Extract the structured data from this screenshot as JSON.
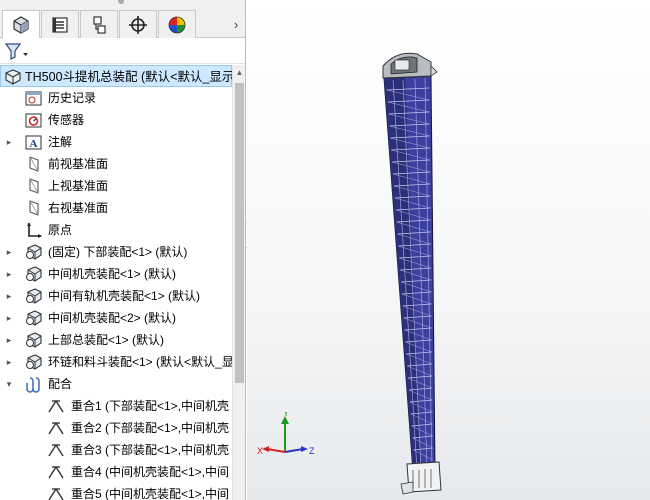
{
  "tabs": [
    {
      "name": "feature-manager",
      "icon": "feature-tree-icon"
    },
    {
      "name": "property-manager",
      "icon": "property-list-icon"
    },
    {
      "name": "configuration-manager",
      "icon": "configuration-icon"
    },
    {
      "name": "dimxpert-manager",
      "icon": "crosshair-icon"
    },
    {
      "name": "display-manager",
      "icon": "appearance-sphere-icon"
    }
  ],
  "tabs_more_glyph": "›",
  "tree": {
    "root": {
      "label": "TH500斗提机总装配 (默认<默认_显示",
      "icon": "assembly-icon"
    },
    "items": [
      {
        "label": "历史记录",
        "icon": "history-folder-icon",
        "expandable": false,
        "indent": 1
      },
      {
        "label": "传感器",
        "icon": "sensor-icon",
        "expandable": false,
        "indent": 1
      },
      {
        "label": "注解",
        "icon": "annotation-icon",
        "expandable": true,
        "indent": 1
      },
      {
        "label": "前视基准面",
        "icon": "plane-icon",
        "expandable": false,
        "indent": 1
      },
      {
        "label": "上视基准面",
        "icon": "plane-icon",
        "expandable": false,
        "indent": 1
      },
      {
        "label": "右视基准面",
        "icon": "plane-icon",
        "expandable": false,
        "indent": 1
      },
      {
        "label": "原点",
        "icon": "origin-icon",
        "expandable": false,
        "indent": 1
      },
      {
        "label": "(固定) 下部装配<1> (默认)",
        "icon": "subassembly-icon",
        "expandable": true,
        "indent": 1
      },
      {
        "label": "中间机壳装配<1> (默认)",
        "icon": "subassembly-icon",
        "expandable": true,
        "indent": 1
      },
      {
        "label": "中间有轨机壳装配<1> (默认)",
        "icon": "subassembly-icon",
        "expandable": true,
        "indent": 1
      },
      {
        "label": "中间机壳装配<2> (默认)",
        "icon": "subassembly-icon",
        "expandable": true,
        "indent": 1
      },
      {
        "label": "上部总装配<1> (默认)",
        "icon": "subassembly-icon",
        "expandable": true,
        "indent": 1
      },
      {
        "label": "环链和料斗装配<1> (默认<默认_显",
        "icon": "subassembly-icon",
        "expandable": true,
        "indent": 1
      },
      {
        "label": "配合",
        "icon": "mates-folder-icon",
        "expandable": true,
        "expanded": true,
        "indent": 1
      },
      {
        "label": "重合1 (下部装配<1>,中间机壳",
        "icon": "coincident-mate-icon",
        "expandable": false,
        "indent": 2
      },
      {
        "label": "重合2 (下部装配<1>,中间机壳",
        "icon": "coincident-mate-icon",
        "expandable": false,
        "indent": 2
      },
      {
        "label": "重合3 (下部装配<1>,中间机壳",
        "icon": "coincident-mate-icon",
        "expandable": false,
        "indent": 2
      },
      {
        "label": "重合4 (中间机壳装配<1>,中间",
        "icon": "coincident-mate-icon",
        "expandable": false,
        "indent": 2
      },
      {
        "label": "重合5 (中间机壳装配<1>,中间",
        "icon": "coincident-mate-icon",
        "expandable": false,
        "indent": 2
      }
    ]
  },
  "viewport": {
    "model": "bucket-elevator-assembly",
    "colors": {
      "casing": "#3b3f9e",
      "casing_edge": "#14163a",
      "head": "#9a9a9a"
    },
    "triad": {
      "x": "X",
      "y": "Y",
      "z": "Z",
      "colors": {
        "x": "#d42020",
        "y": "#1d9a1d",
        "z": "#2a35c8"
      }
    }
  }
}
